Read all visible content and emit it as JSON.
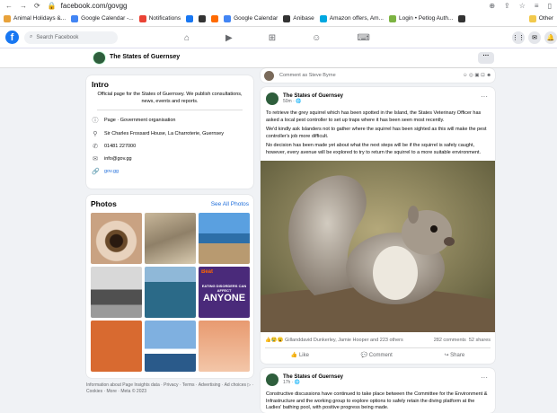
{
  "browser": {
    "url": "facebook.com/govgg",
    "bookmarks": [
      {
        "label": "Animal Holidays &...",
        "color": "#e8a23a"
      },
      {
        "label": "Google Calendar -...",
        "color": "#4285f4"
      },
      {
        "label": "Notifications",
        "color": "#ea4335"
      },
      {
        "label": "",
        "color": "#1877f2"
      },
      {
        "label": "",
        "color": "#333333"
      },
      {
        "label": "",
        "color": "#ff6a00"
      },
      {
        "label": "Google Calendar",
        "color": "#4285f4"
      },
      {
        "label": "Anibase",
        "color": "#333333"
      },
      {
        "label": "Amazon offers, Am...",
        "color": "#00a8e1"
      },
      {
        "label": "Login • Petlog Auth...",
        "color": "#7cb342"
      },
      {
        "label": "",
        "color": "#333333"
      }
    ],
    "other_label": "Other"
  },
  "fb": {
    "search_placeholder": "Search Facebook",
    "page_title": "The States of Guernsey",
    "more_label": "···"
  },
  "intro": {
    "title": "Intro",
    "description": "Official page for the States of Guernsey. We publish consultations, news, events and reports.",
    "category": "Page · Government organisation",
    "address": "Sir Charles Frossard House, La Charroterie, Guernsey",
    "phone": "01481 227000",
    "email": "info@gov.gg",
    "website": "gov.gg"
  },
  "photos": {
    "title": "Photos",
    "see_all": "See All Photos",
    "tile_text_top": "Beat",
    "tile_text_mid": "EATING DISORDERS CAN AFFECT",
    "tile_text_big": "ANYONE"
  },
  "footer": {
    "text": "Information about Page Insights data · Privacy · Terms · Advertising · Ad choices ▷ · Cookies · More · Meta © 2023"
  },
  "comment": {
    "placeholder": "Comment as Steve Byrne"
  },
  "post": {
    "author": "The States of Guernsey",
    "time": "50m · 🌐",
    "p1": "To retrieve the grey squirrel which has been spotted in the Island, the States Veterinary Officer has asked a local pest controller to set up traps where it has been seen most recently.",
    "p2": "We'd kindly ask Islanders not to gather where the squirrel has been sighted as this will make the pest controller's job more difficult.",
    "p3": "No decision has been made yet about what the next steps will be if the squirrel is safely caught, however, every avenue will be explored to try to return the squirrel to a more suitable environment.",
    "reactions": "Gillanddavid Dunkerley, Jamie Hooper and 223 others",
    "comments": "282 comments",
    "shares": "52 shares",
    "like": "Like",
    "comment_btn": "Comment",
    "share": "Share"
  },
  "post2": {
    "author": "The States of Guernsey",
    "time": "17h · 🌐",
    "text": "Constructive discussions have continued to take place between the Committee for the Environment & Infrastructure and the working group to explore options to safely retain the diving platform at the Ladies' bathing pool, with positive progress being made."
  }
}
